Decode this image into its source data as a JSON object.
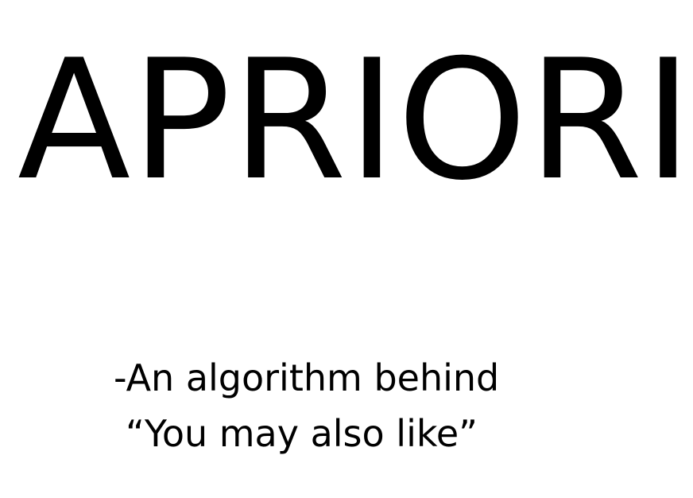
{
  "slide": {
    "title": "APRIORI",
    "subtitle_line1": "-An algorithm behind",
    "subtitle_line2": "“You may also like”"
  },
  "colors": {
    "background": "#ffffff",
    "text": "#000000"
  }
}
